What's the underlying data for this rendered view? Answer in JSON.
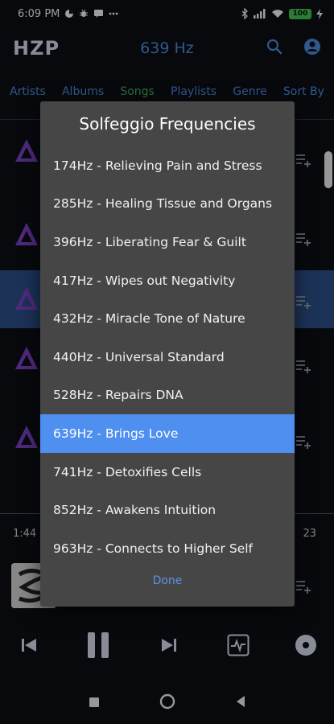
{
  "status_bar": {
    "time": "6:09 PM",
    "battery": "100"
  },
  "app_bar": {
    "logo": "HZP",
    "title": "639 Hz"
  },
  "tabs": [
    {
      "label": "Artists"
    },
    {
      "label": "Albums"
    },
    {
      "label": "Songs",
      "active": true
    },
    {
      "label": "Playlists"
    },
    {
      "label": "Genre"
    },
    {
      "label": "Sort By"
    }
  ],
  "player": {
    "elapsed": "1:44",
    "duration": "23"
  },
  "dialog": {
    "title": "Solfeggio Frequencies",
    "items": [
      {
        "label": "174Hz - Relieving Pain and Stress"
      },
      {
        "label": "285Hz - Healing Tissue and Organs"
      },
      {
        "label": "396Hz - Liberating Fear & Guilt"
      },
      {
        "label": "417Hz - Wipes out Negativity"
      },
      {
        "label": "432Hz - Miracle Tone of Nature"
      },
      {
        "label": "440Hz - Universal Standard"
      },
      {
        "label": "528Hz - Repairs DNA"
      },
      {
        "label": "639Hz - Brings Love",
        "selected": true
      },
      {
        "label": "741Hz - Detoxifies Cells"
      },
      {
        "label": "852Hz - Awakens Intuition"
      },
      {
        "label": "963Hz - Connects to Higher Self"
      }
    ],
    "done_label": "Done"
  },
  "colors": {
    "accent": "#4a87d8",
    "active_tab": "#3fa85b",
    "selected_item": "#4f8ff0",
    "dialog_bg": "#464646"
  }
}
